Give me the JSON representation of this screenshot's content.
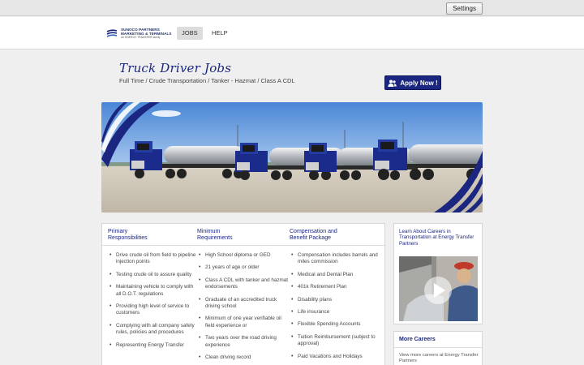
{
  "topbar": {
    "settings_label": "Settings"
  },
  "brand": {
    "line1": "SUNOCO PARTNERS",
    "line2": "MARKETING & TERMINALS",
    "line3": "An ENERGY TRANSFER family"
  },
  "nav": {
    "items": [
      {
        "label": "JOBS",
        "active": true
      },
      {
        "label": "HELP",
        "active": false
      }
    ]
  },
  "job": {
    "title": "Truck Driver Jobs",
    "subtitle": "Full Time / Crude Transportation / Tanker - Hazmat / Class A CDL",
    "apply_label": "Apply Now !"
  },
  "columns": [
    {
      "heading_line1": "Primary",
      "heading_line2": "Responsibilities",
      "items": [
        "Drive crude oil from field to pipeline injection points",
        "Testing crude oil to assure quality",
        "Maintaining vehicle to comply with all D.O.T. regulations",
        "Providing high level of service to customers",
        "Complying with all company safety rules, policies and procedures",
        "Representing Energy Transfer"
      ]
    },
    {
      "heading_line1": "Minimum",
      "heading_line2": "Requirements",
      "items": [
        "High School diploma or GED",
        "21 years of age or older",
        "Class A CDL with tanker and hazmat endorsements",
        "Graduate of an accredited truck driving school",
        "Minimum of one year verifiable oil field experience or",
        "Two years over the road driving experience",
        "Clean driving record"
      ]
    },
    {
      "heading_line1": "Compensation and",
      "heading_line2": "Benefit Package",
      "items": [
        "Compensation includes barrels and miles commission",
        "Medical and Dental Plan",
        "401k Retirement Plan",
        "Disability plans",
        "Life insurance",
        "Flexible Spending Accounts",
        "Tuition Reimbursement (subject to approval)",
        "Paid Vacations and Holidays"
      ]
    }
  ],
  "sidebar": {
    "video_title": "Learn About Careers in Transportation at Energy Transfer Partners",
    "more_title": "More Careers",
    "more_text": "View more careers at Energy Transfer Partners"
  },
  "colors": {
    "brand_navy": "#1a2680",
    "page_bg": "#efefef"
  }
}
